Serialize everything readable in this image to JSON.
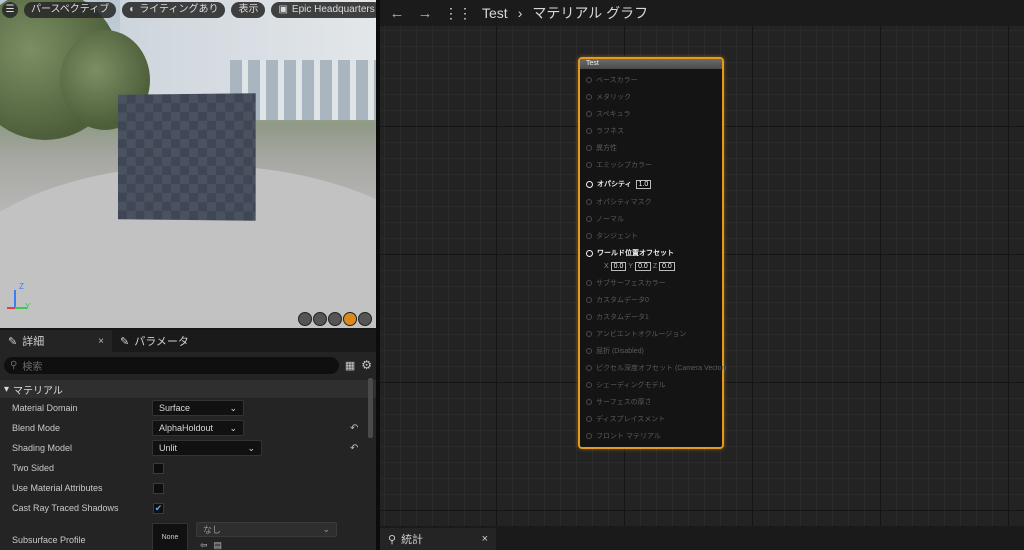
{
  "viewport": {
    "menu_icon": "hamburger-icon",
    "perspective_label": "パースペクティブ",
    "lighting_label": "ライティングあり",
    "show_label": "表示",
    "scene_label": "Epic Headquarters",
    "axis": {
      "z": "Z",
      "y": "Y"
    }
  },
  "details": {
    "tab_label": "詳細",
    "tab_close": "×",
    "params_tab_label": "パラメータ",
    "search_placeholder": "検索",
    "category": "マテリアル",
    "props": {
      "material_domain": {
        "label": "Material Domain",
        "value": "Surface"
      },
      "blend_mode": {
        "label": "Blend Mode",
        "value": "AlphaHoldout"
      },
      "shading_model": {
        "label": "Shading Model",
        "value": "Unlit"
      },
      "two_sided": {
        "label": "Two Sided"
      },
      "use_material_attributes": {
        "label": "Use Material Attributes"
      },
      "cast_ray_traced_shadows": {
        "label": "Cast Ray Traced Shadows"
      },
      "subsurface_profile": {
        "label": "Subsurface Profile",
        "thumb": "None",
        "value": "なし"
      }
    }
  },
  "graph": {
    "breadcrumb": {
      "root": "Test",
      "sep": "›",
      "current": "マテリアル グラフ"
    },
    "node": {
      "title": "Test",
      "pins": [
        {
          "label": "ベースカラー"
        },
        {
          "label": "メタリック"
        },
        {
          "label": "スペキュラ"
        },
        {
          "label": "ラフネス"
        },
        {
          "label": "異方性"
        },
        {
          "label": "エミッシブカラー"
        },
        {
          "label": "オパシティ",
          "value": "1.0"
        },
        {
          "label": "オパシティマスク"
        },
        {
          "label": "ノーマル"
        },
        {
          "label": "タンジェント"
        },
        {
          "label": "ワールド位置オフセット"
        },
        {
          "label": "サブサーフェスカラー"
        },
        {
          "label": "カスタムデータ0"
        },
        {
          "label": "カスタムデータ1"
        },
        {
          "label": "アンビエントオクルージョン"
        },
        {
          "label": "屈折 (Disabled)"
        },
        {
          "label": "ピクセル深度オフセット (Camera Vector)"
        },
        {
          "label": "シェーディングモデル"
        },
        {
          "label": "サーフェスの厚さ"
        },
        {
          "label": "ディスプレイスメント"
        },
        {
          "label": "フロント マテリアル"
        }
      ],
      "wpo": {
        "x_label": "X",
        "x": "0.0",
        "y_label": "Y",
        "y": "0.0",
        "z_label": "Z",
        "z": "0.0"
      }
    },
    "stats_tab": {
      "label": "統計",
      "close": "×"
    }
  },
  "colors": {
    "accent": "#e39a1e"
  }
}
